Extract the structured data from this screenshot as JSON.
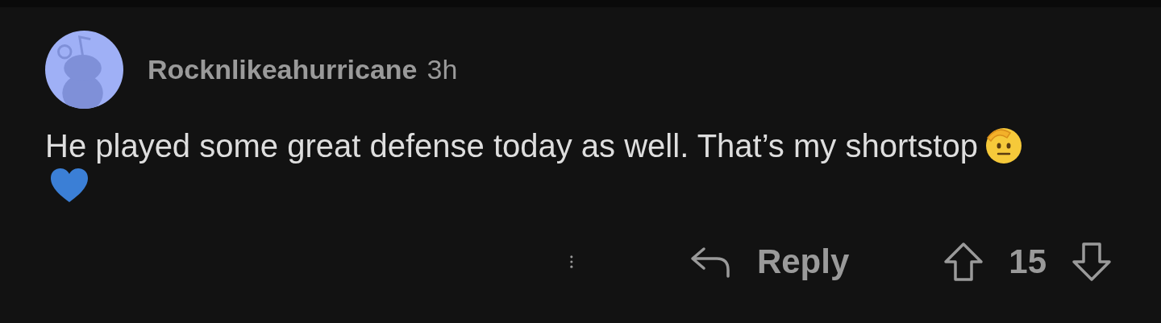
{
  "comment": {
    "author": "Rocknlikeahurricane",
    "time": "3h",
    "text": "He played some great defense today as well. That’s my shortstop"
  },
  "actions": {
    "reply": "Reply",
    "score": "15"
  }
}
